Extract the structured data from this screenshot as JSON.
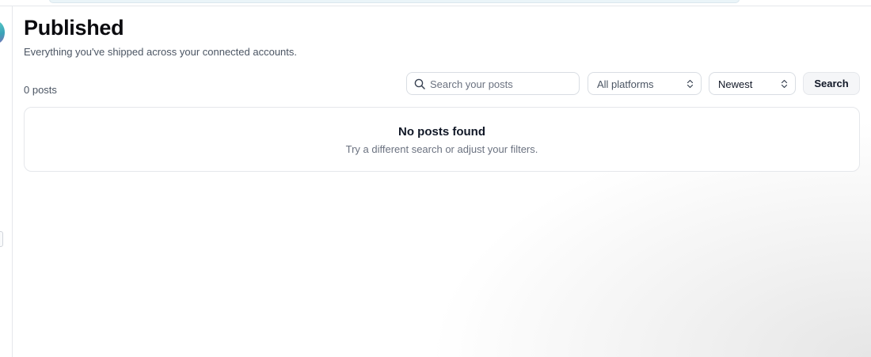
{
  "header": {
    "title": "Published",
    "subtitle": "Everything you've shipped across your connected accounts."
  },
  "toolbar": {
    "post_count": "0 posts",
    "search_placeholder": "Search your posts",
    "search_value": "",
    "search_icon": "search-icon",
    "platform_filter": {
      "selected": "All platforms",
      "icon": "chevron-updown-icon"
    },
    "sort_filter": {
      "selected": "Newest",
      "icon": "chevron-updown-icon"
    },
    "search_button_label": "Search"
  },
  "empty_state": {
    "title": "No posts found",
    "description": "Try a different search or adjust your filters."
  },
  "colors": {
    "text_primary": "#111827",
    "text_muted": "#4b5563",
    "border": "#e5e7eb",
    "button_bg": "#f5f6f8"
  }
}
